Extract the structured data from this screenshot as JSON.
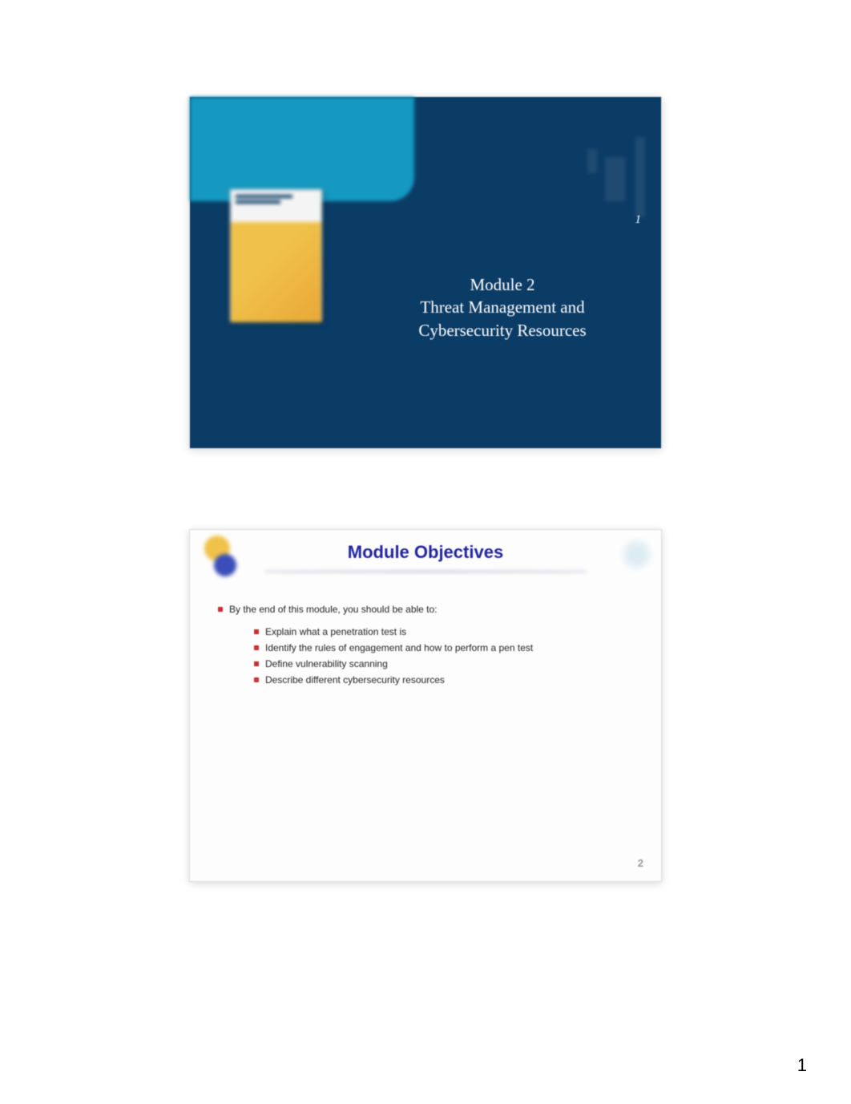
{
  "page_number": "1",
  "slide1": {
    "number": "1",
    "title_line1": "Module 2",
    "title_line2": "Threat Management and",
    "title_line3": "Cybersecurity Resources"
  },
  "slide2": {
    "header": "Module Objectives",
    "intro": "By the end of this module, you should be able to:",
    "objectives": [
      "Explain what a penetration test is",
      "Identify the rules of engagement and how to perform a pen test",
      "Define vulnerability scanning",
      "Describe different cybersecurity resources"
    ],
    "number": "2"
  }
}
